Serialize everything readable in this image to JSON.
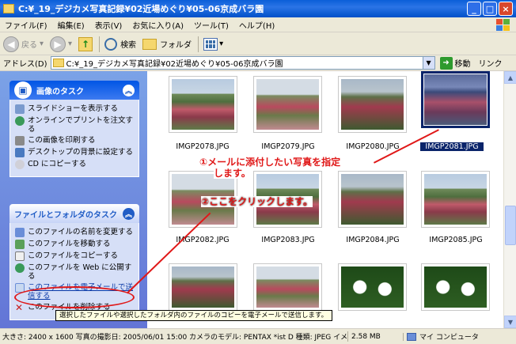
{
  "window": {
    "title": "C:¥_19_デジカメ写真記録¥02近場めぐり¥05-06京成バラ園"
  },
  "menu": [
    "ファイル(F)",
    "編集(E)",
    "表示(V)",
    "お気に入り(A)",
    "ツール(T)",
    "ヘルプ(H)"
  ],
  "toolbar": {
    "back": "戻る",
    "search": "検索",
    "folders": "フォルダ"
  },
  "address": {
    "label": "アドレス(D)",
    "path": "C:¥_19_デジカメ写真記録¥02近場めぐり¥05-06京成バラ園",
    "go": "移動",
    "links": "リンク"
  },
  "picture_tasks": {
    "title": "画像のタスク",
    "items": [
      "スライドショーを表示する",
      "オンラインでプリントを注文する",
      "この画像を印刷する",
      "デスクトップの背景に設定する",
      "CD にコピーする"
    ]
  },
  "file_tasks": {
    "title": "ファイルとフォルダのタスク",
    "items": [
      "このファイルの名前を変更する",
      "このファイルを移動する",
      "このファイルをコピーする",
      "このファイルを Web に公開する",
      "このファイルを電子メールで送信する",
      "このファイルを削除する"
    ]
  },
  "thumbnails": [
    "IMGP2078.JPG",
    "IMGP2079.JPG",
    "IMGP2080.JPG",
    "IMGP2081.JPG",
    "IMGP2082.JPG",
    "IMGP2083.JPG",
    "IMGP2084.JPG",
    "IMGP2085.JPG"
  ],
  "annotations": {
    "step1_line1": "①メールに添付したい写真を指定",
    "step1_line2": "します。",
    "step2": "②ここをクリックします。"
  },
  "tooltip": "選択したファイルや選択したフォルダ内のファイルのコピーを電子メールで送信します。",
  "status": {
    "details": "大きさ: 2400 x 1600 写真の撮影日: 2005/06/01 15:00 カメラのモデル: PENTAX *ist D 種類: JPEG イメージ",
    "size": "2.58 MB",
    "zone": "マイ コンピュータ"
  },
  "colors": {
    "annotation": "#E01818",
    "selection": "#0A246A",
    "task_pane": "#6375D6"
  }
}
